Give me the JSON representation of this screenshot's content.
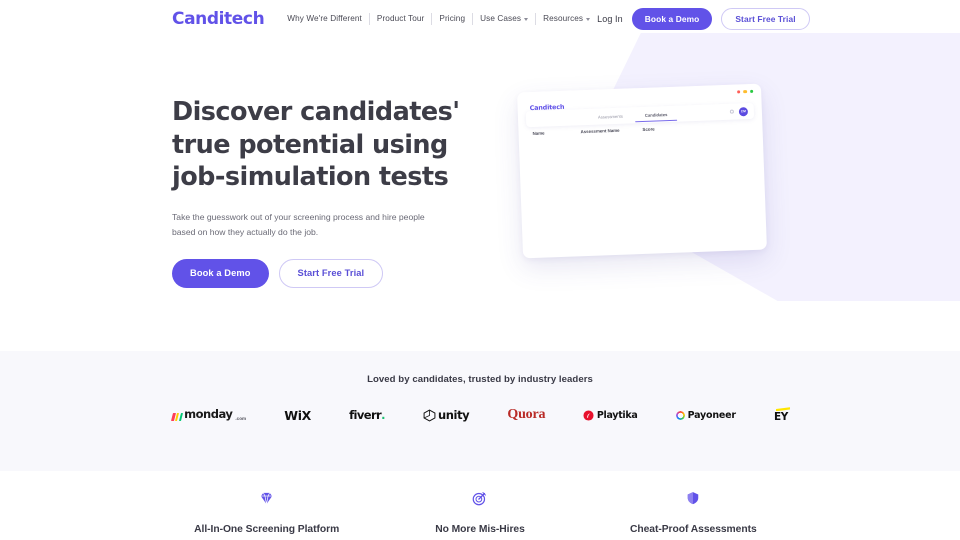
{
  "nav": {
    "logo": "Canditech",
    "links": [
      {
        "label": "Why We're Different",
        "has_caret": false
      },
      {
        "label": "Product Tour",
        "has_caret": false
      },
      {
        "label": "Pricing",
        "has_caret": false
      },
      {
        "label": "Use Cases",
        "has_caret": true
      },
      {
        "label": "Resources",
        "has_caret": true
      }
    ],
    "login_label": "Log In",
    "demo_label": "Book a Demo",
    "trial_label": "Start Free Trial"
  },
  "hero": {
    "heading_line1": "Discover candidates'",
    "heading_line2": "true potential using",
    "heading_line3": "job-simulation tests",
    "subtext": "Take the guesswork out of your screening process and hire people based on how they actually do the job.",
    "primary_button": "Book a Demo",
    "secondary_button": "Start Free Trial"
  },
  "mock": {
    "logo": "Canditech",
    "tabs": [
      {
        "label": "Assessments",
        "active": false
      },
      {
        "label": "Candidates",
        "active": true
      }
    ],
    "avatar_initials": "CM",
    "table_headers": [
      "Name",
      "Assessment Name",
      "Score"
    ]
  },
  "band": {
    "title": "Loved by candidates, trusted by industry leaders",
    "logos": [
      {
        "name": "monday.com",
        "text": "monday",
        "suffix": ".com"
      },
      {
        "name": "Wix",
        "text": "WiX"
      },
      {
        "name": "Fiverr",
        "text": "fiverr",
        "dot": "."
      },
      {
        "name": "Unity",
        "text": "unity"
      },
      {
        "name": "Quora",
        "text": "Quora"
      },
      {
        "name": "Playtika",
        "text": "Playtika"
      },
      {
        "name": "Payoneer",
        "text": "Payoneer"
      },
      {
        "name": "EY",
        "text": "EY"
      }
    ]
  },
  "features": [
    {
      "icon": "diamond-icon",
      "title": "All-In-One Screening Platform"
    },
    {
      "icon": "target-icon",
      "title": "No More Mis-Hires"
    },
    {
      "icon": "shield-icon",
      "title": "Cheat-Proof Assessments"
    }
  ],
  "colors": {
    "brand_purple": "#6152e8",
    "band_bg": "#f8f8fc",
    "blob": "#f3f1fe",
    "heading": "#3d3d47"
  }
}
